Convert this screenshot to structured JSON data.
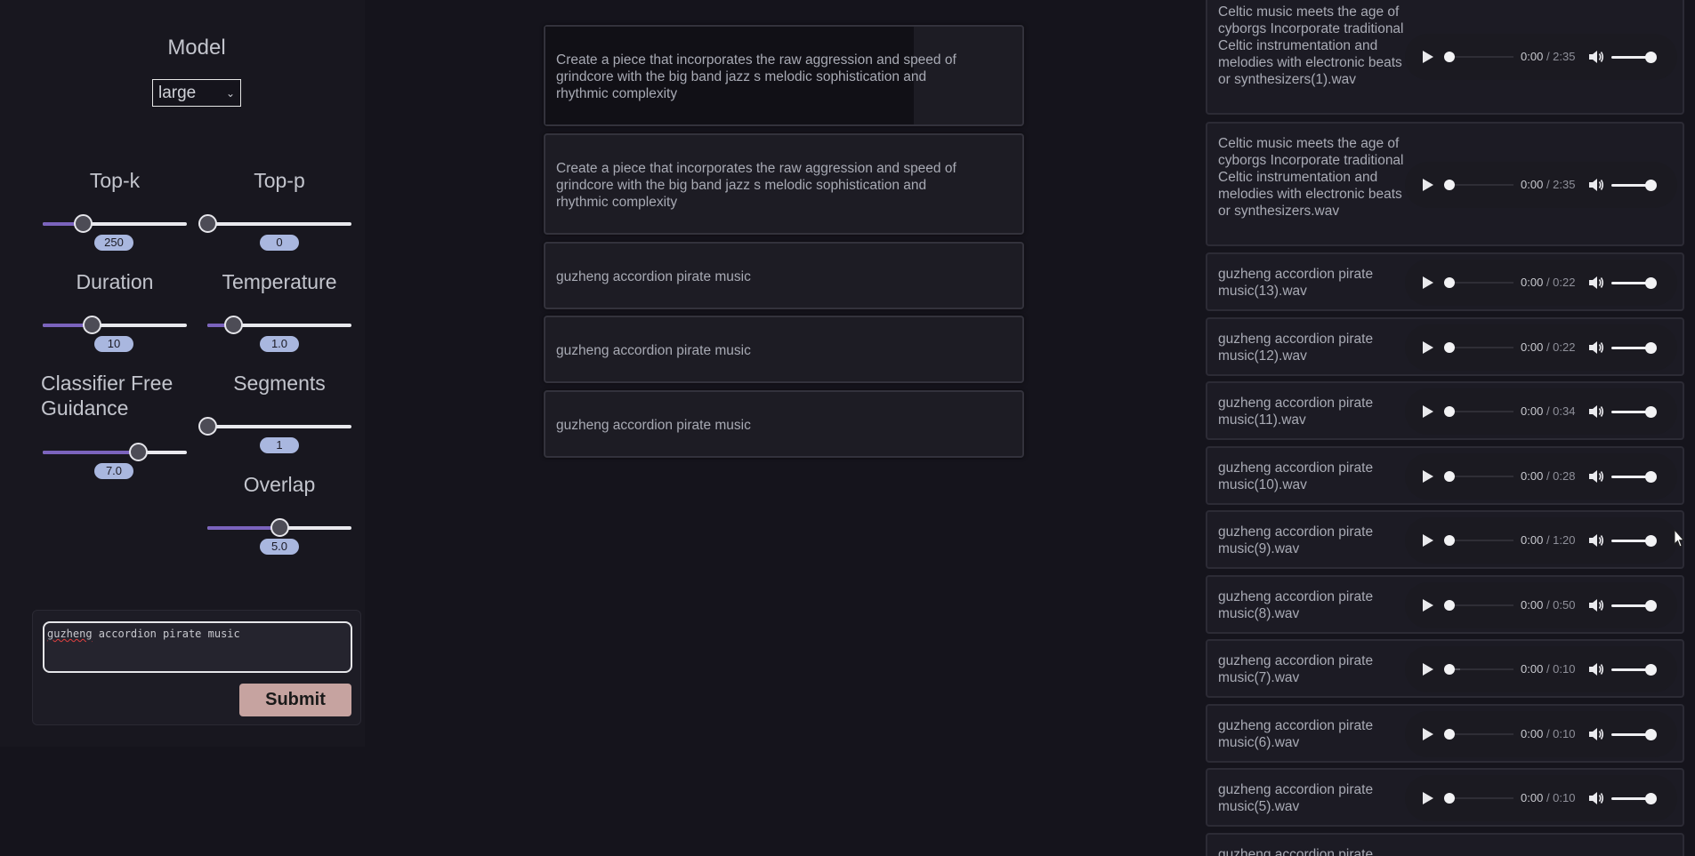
{
  "settings": {
    "model_label": "Model",
    "model_value": "large",
    "sliders": {
      "topk": {
        "label": "Top-k",
        "value": "250",
        "fraction": 0.28
      },
      "topp": {
        "label": "Top-p",
        "value": "0",
        "fraction": 0.0
      },
      "duration": {
        "label": "Duration",
        "value": "10",
        "fraction": 0.34
      },
      "temperature": {
        "label": "Temperature",
        "value": "1.0",
        "fraction": 0.18
      },
      "cfg": {
        "label": "Classifier Free Guidance",
        "value": "7.0",
        "fraction": 0.66
      },
      "segments": {
        "label": "Segments",
        "value": "1",
        "fraction": 0.0
      },
      "overlap": {
        "label": "Overlap",
        "value": "5.0",
        "fraction": 0.5
      }
    },
    "prompt_value": "guzheng accordion pirate music",
    "prompt_misspelled": "guzheng",
    "prompt_rest": " accordion pirate music",
    "submit_label": "Submit"
  },
  "history": [
    "Create a piece that incorporates the raw aggression and speed of grindcore with the big band jazz s melodic sophistication and rhythmic complexity",
    "Create a piece that incorporates the raw aggression and speed of grindcore with the big band jazz s melodic sophistication and rhythmic complexity",
    "guzheng accordion pirate music",
    "guzheng accordion pirate music",
    "guzheng accordion pirate music"
  ],
  "audio_files": [
    {
      "name": "Celtic music meets the age of cyborgs Incorporate traditional Celtic instrumentation and melodies with electronic beats or synthesizers(1).wav",
      "current": "0:00",
      "duration": "/ 2:35"
    },
    {
      "name": "Celtic music meets the age of cyborgs Incorporate traditional Celtic instrumentation and melodies with electronic beats or synthesizers.wav",
      "current": "0:00",
      "duration": "/ 2:35"
    },
    {
      "name": "guzheng accordion pirate music(13).wav",
      "current": "0:00",
      "duration": "/ 0:22"
    },
    {
      "name": "guzheng accordion pirate music(12).wav",
      "current": "0:00",
      "duration": "/ 0:22"
    },
    {
      "name": "guzheng accordion pirate music(11).wav",
      "current": "0:00",
      "duration": "/ 0:34"
    },
    {
      "name": "guzheng accordion pirate music(10).wav",
      "current": "0:00",
      "duration": "/ 0:28"
    },
    {
      "name": "guzheng accordion pirate music(9).wav",
      "current": "0:00",
      "duration": "/ 1:20"
    },
    {
      "name": "guzheng accordion pirate music(8).wav",
      "current": "0:00",
      "duration": "/ 0:50"
    },
    {
      "name": "guzheng accordion pirate music(7).wav",
      "current": "0:00",
      "duration": "/ 0:10"
    },
    {
      "name": "guzheng accordion pirate music(6).wav",
      "current": "0:00",
      "duration": "/ 0:10"
    },
    {
      "name": "guzheng accordion pirate music(5).wav",
      "current": "0:00",
      "duration": "/ 0:10"
    },
    {
      "name": "guzheng accordion pirate",
      "current": "",
      "duration": ""
    }
  ]
}
